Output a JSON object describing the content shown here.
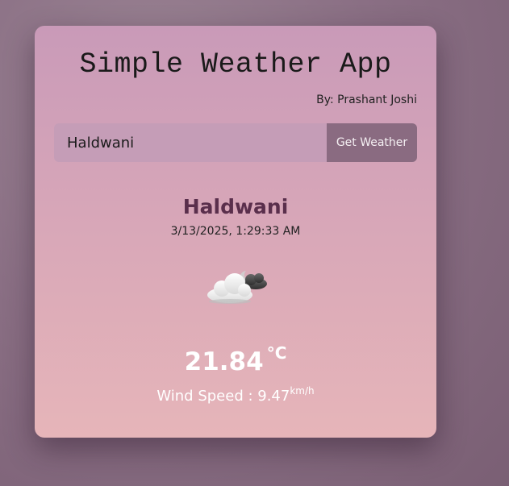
{
  "app": {
    "title": "Simple Weather App",
    "author": "By: Prashant Joshi"
  },
  "search": {
    "value": "Haldwani",
    "button_label": "Get Weather"
  },
  "weather": {
    "city": "Haldwani",
    "datetime": "3/13/2025, 1:29:33 AM",
    "icon": "cloudy-night-icon",
    "temperature": "21.84",
    "temperature_unit": "°C",
    "wind_label": "Wind Speed : 9.47",
    "wind_unit": "km/h"
  },
  "colors": {
    "card_top": "#c99ab8",
    "card_bottom": "#e6b5b9",
    "button": "#8a6b81",
    "city": "#5a2f4c"
  }
}
